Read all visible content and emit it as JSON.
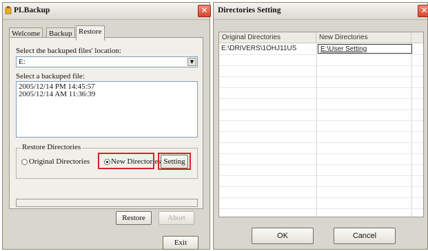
{
  "left_window": {
    "title": "PLBackup",
    "tabs": [
      {
        "label": "Welcome"
      },
      {
        "label": "Backup"
      },
      {
        "label": "Restore"
      }
    ],
    "location_label": "Select the backuped files' location:",
    "location_value": "E:",
    "file_label": "Select a backuped file:",
    "files": [
      {
        "label": "2005/12/14  PM 14:45:57"
      },
      {
        "label": "2005/12/14  AM 11:36:39"
      }
    ],
    "restore_dirs": {
      "title": "Restore Directories",
      "original_label": "Original Directories",
      "new_label": "New Directories",
      "selected": "new"
    },
    "setting_button": "Setting",
    "restore_button": "Restore",
    "abort_button": "Abort",
    "exit_button": "Exit"
  },
  "right_window": {
    "title": "Directories Setting",
    "columns": [
      "Original Directories",
      "New Directories"
    ],
    "rows": [
      {
        "original": "E:\\DRIVERS\\1OHJ11US",
        "new": "E:\\User Setting"
      }
    ],
    "ok_button": "OK",
    "cancel_button": "Cancel"
  },
  "colors": {
    "highlight": "#d8212b",
    "close_button": "#d8452c"
  }
}
